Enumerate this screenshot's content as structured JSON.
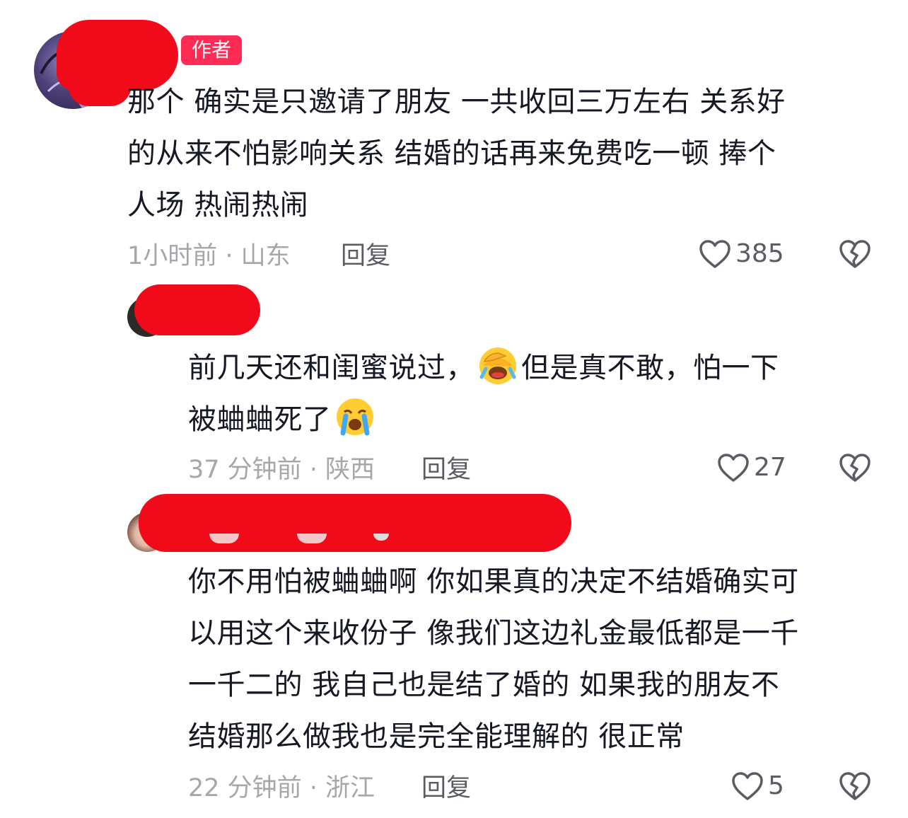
{
  "comments": [
    {
      "badge": "作者",
      "lines": [
        "那个 确实是只邀请了朋友 一共收回三万左右 关系好",
        "的从来不怕影响关系 结婚的话再来免费吃一顿 捧个",
        "人场 热闹热闹"
      ],
      "time_location": "1小时前 · 山东",
      "reply_label": "回复",
      "likes": "385"
    },
    {
      "line1_part1": "前几天还和闺蜜说过，",
      "line1_part2": "但是真不敢，怕一下",
      "line2": "被蛐蛐死了",
      "emoji1": "face-palm-crying-emoji",
      "emoji2": "loudly-crying-emoji",
      "time_location": "37 分钟前 · 陕西",
      "reply_label": "回复",
      "likes": "27"
    },
    {
      "lines": [
        "你不用怕被蛐蛐啊 你如果真的决定不结婚确实可",
        "以用这个来收份子 像我们这边礼金最低都是一千",
        "一千二的 我自己也是结了婚的 如果我的朋友不",
        "结婚那么做我也是完全能理解的 很正常"
      ],
      "time_location": "22 分钟前 · 浙江",
      "reply_label": "回复",
      "likes": "5"
    }
  ],
  "colors": {
    "redaction": "#f10b1a",
    "author_badge": "#fe2c55",
    "text": "#161823",
    "meta": "#a6a7ab"
  }
}
